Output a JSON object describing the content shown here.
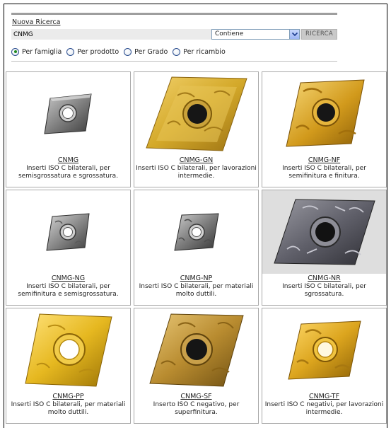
{
  "header": {
    "new_search_link": "Nuova Ricerca"
  },
  "search": {
    "query_value": "CNMG",
    "match_select_value": "Contiene",
    "search_button": "RICERCA"
  },
  "filters": [
    {
      "label": "Per famiglia",
      "selected": true
    },
    {
      "label": "Per prodotto",
      "selected": false
    },
    {
      "label": "Per Grado",
      "selected": false
    },
    {
      "label": "Per ricambio",
      "selected": false
    }
  ],
  "products": [
    {
      "name": "CNMG",
      "description": "Inserti ISO C bilaterali, per semisgrossatura e sgrossatura.",
      "icon": "insert-grey-small"
    },
    {
      "name": "CNMG-GN",
      "description": "Inserti ISO C bilaterali, per lavorazioni intermedie.",
      "icon": "insert-gold-large"
    },
    {
      "name": "CNMG-NF",
      "description": "Inserti ISO C bilaterali, per semifinitura e finitura.",
      "icon": "insert-gold-large"
    },
    {
      "name": "CNMG-NG",
      "description": "Inserti ISO C bilaterali, per semifinitura e semisgrossatura.",
      "icon": "insert-grey-small"
    },
    {
      "name": "CNMG-NP",
      "description": "Inserti ISO C bilaterali, per materiali molto duttili.",
      "icon": "insert-grey-small"
    },
    {
      "name": "CNMG-NR",
      "description": "Inserti ISO C bilaterali, per sgrossatura.",
      "icon": "insert-darkgrey-large"
    },
    {
      "name": "CNMG-PP",
      "description": "Inserti ISO C bilaterali, per materiali molto duttili.",
      "icon": "insert-gold-large"
    },
    {
      "name": "CNMG-SF",
      "description": "Inserto ISO C negativo, per superfinitura.",
      "icon": "insert-gold-large"
    },
    {
      "name": "CNMG-TF",
      "description": "Inserti ISO C negativi, per lavorazioni intermedie.",
      "icon": "insert-gold-small"
    }
  ],
  "colors": {
    "gold": "#d4a92a",
    "gold_dark": "#a47a12",
    "steel": "#8c8c8c",
    "steel_dark": "#4a4a4a",
    "accent_radio": "#1f8a1f"
  }
}
